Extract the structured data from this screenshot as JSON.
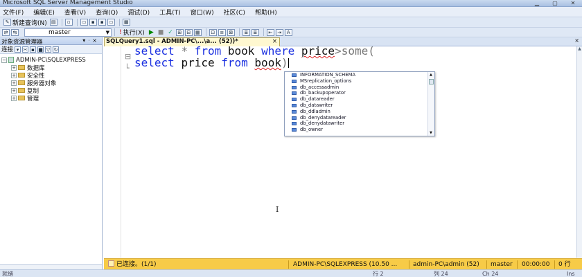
{
  "window": {
    "title": "Microsoft SQL Server Management Studio"
  },
  "menubar": [
    "文件(F)",
    "编辑(E)",
    "查看(V)",
    "查询(Q)",
    "调试(D)",
    "工具(T)",
    "窗口(W)",
    "社区(C)",
    "帮助(H)"
  ],
  "toolbar1": {
    "new_query": "新建查询(N)"
  },
  "toolbar2": {
    "database": "master",
    "execute": "执行(X)"
  },
  "object_explorer": {
    "title": "对象资源管理器",
    "connect": "连接",
    "server": "ADMIN-PC\\SQLEXPRESS",
    "nodes": [
      "数据库",
      "安全性",
      "服务器对象",
      "复制",
      "管理"
    ]
  },
  "editor": {
    "tab_title": "SQLQuery1.sql - ADMIN-PC\\...\\a... (52))*",
    "tab_close": "×",
    "line1": {
      "kw1": "select",
      "star": "*",
      "kw2": "from",
      "table": "book",
      "kw3": "where",
      "col": "price",
      "op": ">",
      "tail": "some("
    },
    "line2": {
      "kw1": "select",
      "col": "price",
      "kw2": "from",
      "table": "book",
      "close": ")"
    }
  },
  "intellisense": {
    "items": [
      "INFORMATION_SCHEMA",
      "MSreplication_options",
      "db_accessadmin",
      "db_backupoperator",
      "db_datareader",
      "db_datawriter",
      "db_ddladmin",
      "db_denydatareader",
      "db_denydatawriter",
      "db_owner"
    ]
  },
  "statusbar": {
    "connected": "已连接。(1/1)",
    "server": "ADMIN-PC\\SQLEXPRESS (10.50 ...",
    "user": "admin-PC\\admin (52)",
    "database": "master",
    "time": "00:00:00",
    "rows": "0 行"
  },
  "app_status": {
    "left": "就绪",
    "row": "行 2",
    "col": "列 24",
    "ch": "Ch 24",
    "mode": "Ins"
  },
  "colors": {
    "keyword": "#1a2fe0",
    "status_bar": "#f7cb47"
  }
}
